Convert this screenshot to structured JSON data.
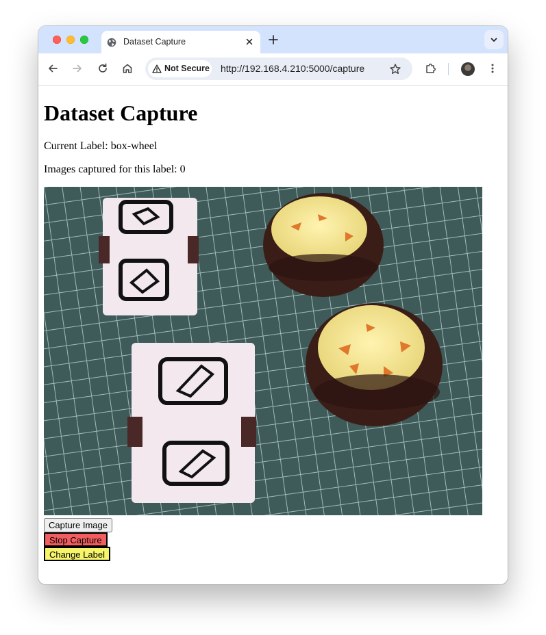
{
  "browser": {
    "tab": {
      "title": "Dataset Capture"
    },
    "address_bar": {
      "security_chip": "Not Secure",
      "url": "http://192.168.4.210:5000/capture"
    }
  },
  "page": {
    "title": "Dataset Capture",
    "current_label_text": "Current Label: box-wheel",
    "images_captured_text": "Images captured for this label: 0",
    "camera_feed": {
      "description_icon": "camera-frame-image"
    },
    "buttons": {
      "capture": "Capture Image",
      "stop": "Stop Capture",
      "change_label": "Change Label"
    }
  },
  "colors": {
    "tabstrip": "#d3e3fd",
    "stop_button": "#f25d5f",
    "change_label_button": "#f7f56a"
  }
}
